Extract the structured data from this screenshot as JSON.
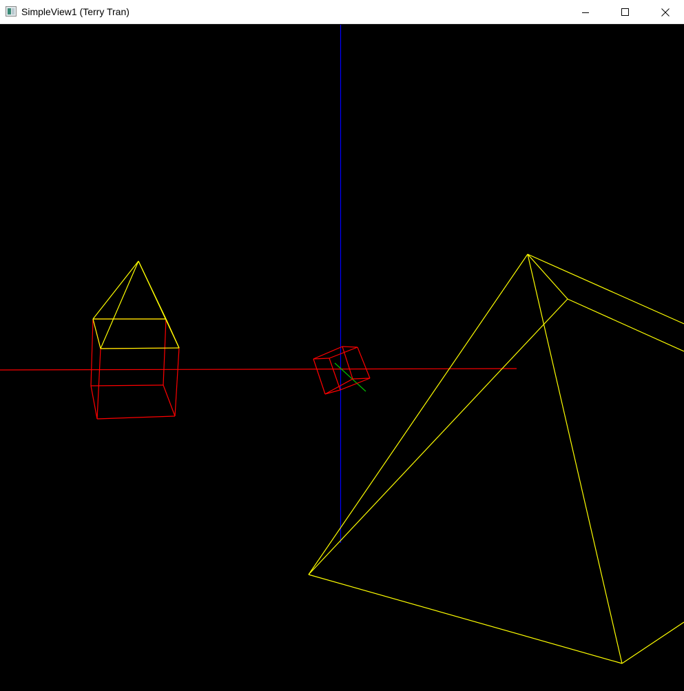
{
  "window": {
    "title": "SimpleView1 (Terry Tran)",
    "icon": "app-window-icon",
    "controls": {
      "minimize_icon": "minimize-icon",
      "maximize_icon": "maximize-icon",
      "close_icon": "close-icon"
    }
  },
  "scene": {
    "background_color": "#000000",
    "axis_colors": {
      "x_axis": "#ff0000",
      "y_axis": "#0000ff",
      "z_axis": "#00c000"
    },
    "object_colors": {
      "wireframe_cube": "#ff0000",
      "wireframe_pyramid": "#ffff00"
    }
  }
}
